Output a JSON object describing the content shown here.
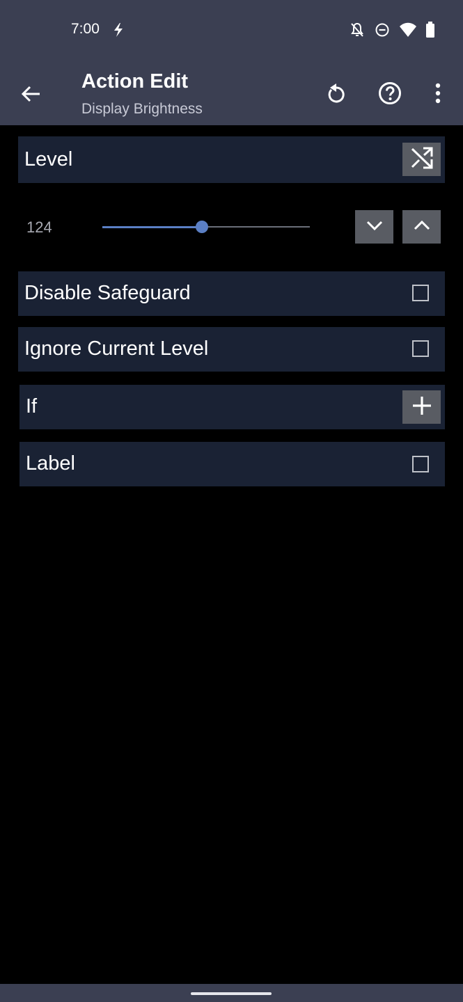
{
  "status": {
    "time": "7:00",
    "icons": [
      "charging-bolt-icon",
      "notifications-off-icon",
      "do-not-disturb-icon",
      "wifi-icon",
      "battery-icon"
    ]
  },
  "appbar": {
    "title": "Action Edit",
    "subtitle": "Display Brightness",
    "actions": [
      "back-arrow-icon",
      "reset-icon",
      "help-icon",
      "overflow-menu-icon"
    ]
  },
  "level": {
    "label": "Level",
    "value": "124",
    "slider_fraction": 0.48,
    "random_icon": "shuffle-icon"
  },
  "options": {
    "disable_safeguard": {
      "label": "Disable Safeguard",
      "checked": false
    },
    "ignore_current_level": {
      "label": "Ignore Current Level",
      "checked": false
    },
    "if": {
      "label": "If",
      "icon": "plus-icon"
    },
    "label": {
      "label": "Label",
      "checked": false
    }
  },
  "colors": {
    "appbar": "#3b3f52",
    "row_background": "#1a2234",
    "accent": "#5b7fc4",
    "button_gray": "#595c63"
  }
}
